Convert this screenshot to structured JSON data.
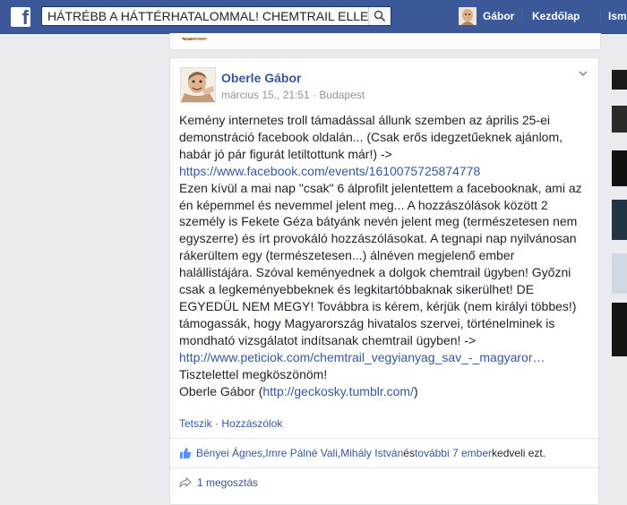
{
  "topbar": {
    "logo": "f",
    "search_value": "HÁTRÉBB A HÁTTÉRHATALOMMAL! CHEMTRAIL ELLEN",
    "search_icon": "search-icon",
    "user_name": "Gábor",
    "home_label": "Kezdőlap",
    "friends_label": "Ismer"
  },
  "post": {
    "author": "Oberle Gábor",
    "date": "március 15., 21:51",
    "location": "Budapest",
    "body": {
      "p1_a": "Kemény internetes troll támadással állunk szemben az április 25-ei demonstráció facebook oldalán... (Csak erős idegzetűeknek ajánlom, habár jó pár figurát letiltottunk már!) -> ",
      "link1": "https://www.facebook.com/events/1610075725874778",
      "p2": "Ezen kívül a mai nap \"csak\" 6 álprofilt jelentettem a facebooknak, ami az én képemmel és nevemmel jelent meg... A hozzászólások között 2 személy is Fekete Géza bátyánk nevén jelent meg (természetesen nem egyszerre) és írt provokáló hozzászólásokat. A tegnapi nap nyilvánosan rákerültem egy (természetesen...) álnéven megjelenő ember halállistájára. Szóval keményednek a dolgok chemtrail ügyben! Győzni csak a legkeményebbeknek és legkitartóbbaknak sikerülhet! DE EGYEDÜL NEM MEGY! Továbbra is kérem, kérjük (nem királyi többes!) támogassák, hogy Magyarország hivatalos szervei, történelminek is mondható vizsgálatot indítsanak chemtrail ügyben! ->",
      "link2": "http://www.peticiok.com/chemtrail_vegyianyag_sav_-_magyaror…",
      "p3": "Tisztelettel megköszönöm!",
      "sig_a": "Oberle Gábor (",
      "link3": "http://geckosky.tumblr.com/",
      "sig_b": ")"
    },
    "actions": {
      "like": "Tetszik",
      "separator": " · ",
      "comment": "Hozzászólok"
    },
    "likes": {
      "p1": "Bényei Ágnes",
      "p2": "Imre Pálné Vali",
      "p3": "Mihály István",
      "and": " és ",
      "more": "további 7 ember",
      "suffix": " kedveli ezt."
    },
    "shares": "1 megosztás"
  },
  "colors": {
    "brand": "#3b5998",
    "link": "#365899",
    "meta": "#90949c"
  }
}
